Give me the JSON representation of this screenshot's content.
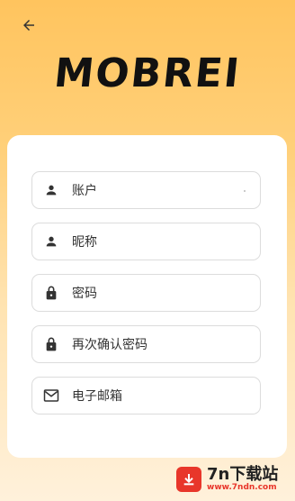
{
  "header": {
    "back_icon": "arrow-left-icon"
  },
  "logo": {
    "text": "MOBREI"
  },
  "form": {
    "fields": [
      {
        "icon": "person-icon",
        "placeholder": "账户"
      },
      {
        "icon": "person-icon",
        "placeholder": "昵称"
      },
      {
        "icon": "lock-icon",
        "placeholder": "密码"
      },
      {
        "icon": "lock-icon",
        "placeholder": "再次确认密码"
      },
      {
        "icon": "mail-icon",
        "placeholder": "电子邮箱"
      }
    ]
  },
  "watermark": {
    "title": "7n下载站",
    "url": "www.7ndn.com"
  },
  "colors": {
    "accent": "#ffc45e",
    "watermark_red": "#e8362a"
  }
}
